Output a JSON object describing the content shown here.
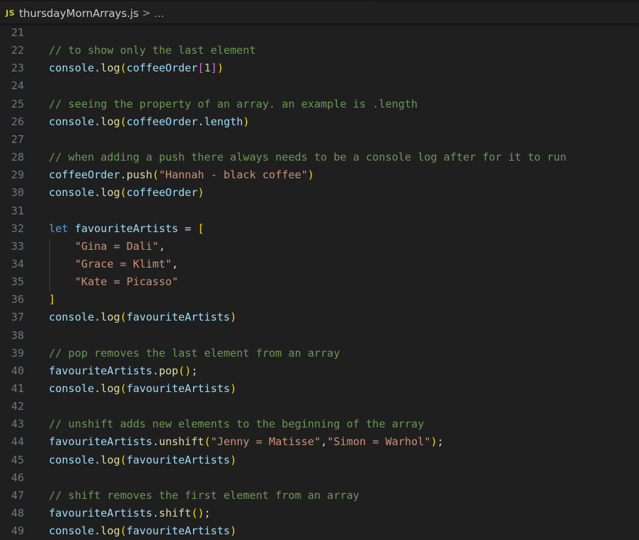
{
  "breadcrumb": {
    "language_icon": "JS",
    "language_icon_name": "javascript-file-icon",
    "file_name": "thursdayMornArrays.js",
    "separator": ">",
    "more": "..."
  },
  "colors": {
    "background": "#1f1f1f",
    "line_number": "#6e7681",
    "comment": "#6a9955",
    "variable": "#9cdcfe",
    "function": "#dcdcaa",
    "string": "#ce9178",
    "keyword": "#569cd6",
    "bracket_level1": "#ffd700",
    "bracket_level2": "#da70d6",
    "number": "#b5cea8",
    "js_icon": "#cbcb41"
  },
  "editor": {
    "lines": [
      {
        "n": "21",
        "tokens": []
      },
      {
        "n": "22",
        "tokens": [
          {
            "t": "comment",
            "v": "// to show only the last element"
          }
        ]
      },
      {
        "n": "23",
        "tokens": [
          {
            "t": "var",
            "v": "console"
          },
          {
            "t": "punc",
            "v": "."
          },
          {
            "t": "fn",
            "v": "log"
          },
          {
            "t": "b1",
            "v": "("
          },
          {
            "t": "var",
            "v": "coffeeOrder"
          },
          {
            "t": "b2",
            "v": "["
          },
          {
            "t": "num",
            "v": "1"
          },
          {
            "t": "b2",
            "v": "]"
          },
          {
            "t": "b1",
            "v": ")"
          }
        ]
      },
      {
        "n": "24",
        "tokens": []
      },
      {
        "n": "25",
        "tokens": [
          {
            "t": "comment",
            "v": "// seeing the property of an array. an example is .length"
          }
        ]
      },
      {
        "n": "26",
        "tokens": [
          {
            "t": "var",
            "v": "console"
          },
          {
            "t": "punc",
            "v": "."
          },
          {
            "t": "fn",
            "v": "log"
          },
          {
            "t": "b1",
            "v": "("
          },
          {
            "t": "var",
            "v": "coffeeOrder"
          },
          {
            "t": "punc",
            "v": "."
          },
          {
            "t": "var",
            "v": "length"
          },
          {
            "t": "b1",
            "v": ")"
          }
        ]
      },
      {
        "n": "27",
        "tokens": []
      },
      {
        "n": "28",
        "tokens": [
          {
            "t": "comment",
            "v": "// when adding a push there always needs to be a console log after for it to run"
          }
        ]
      },
      {
        "n": "29",
        "tokens": [
          {
            "t": "var",
            "v": "coffeeOrder"
          },
          {
            "t": "punc",
            "v": "."
          },
          {
            "t": "fn",
            "v": "push"
          },
          {
            "t": "b1",
            "v": "("
          },
          {
            "t": "str",
            "v": "\"Hannah - black coffee\""
          },
          {
            "t": "b1",
            "v": ")"
          }
        ]
      },
      {
        "n": "30",
        "tokens": [
          {
            "t": "var",
            "v": "console"
          },
          {
            "t": "punc",
            "v": "."
          },
          {
            "t": "fn",
            "v": "log"
          },
          {
            "t": "b1",
            "v": "("
          },
          {
            "t": "var",
            "v": "coffeeOrder"
          },
          {
            "t": "b1",
            "v": ")"
          }
        ]
      },
      {
        "n": "31",
        "tokens": []
      },
      {
        "n": "32",
        "tokens": [
          {
            "t": "kw",
            "v": "let"
          },
          {
            "t": "punc",
            "v": " "
          },
          {
            "t": "var",
            "v": "favouriteArtists"
          },
          {
            "t": "punc",
            "v": " = "
          },
          {
            "t": "b1",
            "v": "["
          }
        ]
      },
      {
        "n": "33",
        "tokens": [
          {
            "t": "punc",
            "v": "    "
          },
          {
            "t": "str",
            "v": "\"Gina = Dali\""
          },
          {
            "t": "punc",
            "v": ","
          }
        ]
      },
      {
        "n": "34",
        "tokens": [
          {
            "t": "punc",
            "v": "    "
          },
          {
            "t": "str",
            "v": "\"Grace = Klimt\""
          },
          {
            "t": "punc",
            "v": ","
          }
        ]
      },
      {
        "n": "35",
        "tokens": [
          {
            "t": "punc",
            "v": "    "
          },
          {
            "t": "str",
            "v": "\"Kate = Picasso\""
          }
        ]
      },
      {
        "n": "36",
        "tokens": [
          {
            "t": "b1",
            "v": "]"
          }
        ]
      },
      {
        "n": "37",
        "tokens": [
          {
            "t": "var",
            "v": "console"
          },
          {
            "t": "punc",
            "v": "."
          },
          {
            "t": "fn",
            "v": "log"
          },
          {
            "t": "b1",
            "v": "("
          },
          {
            "t": "var",
            "v": "favouriteArtists"
          },
          {
            "t": "b1",
            "v": ")"
          }
        ]
      },
      {
        "n": "38",
        "tokens": []
      },
      {
        "n": "39",
        "tokens": [
          {
            "t": "comment",
            "v": "// pop removes the last element from an array"
          }
        ]
      },
      {
        "n": "40",
        "tokens": [
          {
            "t": "var",
            "v": "favouriteArtists"
          },
          {
            "t": "punc",
            "v": "."
          },
          {
            "t": "fn",
            "v": "pop"
          },
          {
            "t": "b1",
            "v": "()"
          },
          {
            "t": "punc",
            "v": ";"
          }
        ]
      },
      {
        "n": "41",
        "tokens": [
          {
            "t": "var",
            "v": "console"
          },
          {
            "t": "punc",
            "v": "."
          },
          {
            "t": "fn",
            "v": "log"
          },
          {
            "t": "b1",
            "v": "("
          },
          {
            "t": "var",
            "v": "favouriteArtists"
          },
          {
            "t": "b1",
            "v": ")"
          }
        ]
      },
      {
        "n": "42",
        "tokens": []
      },
      {
        "n": "43",
        "tokens": [
          {
            "t": "comment",
            "v": "// unshift adds new elements to the beginning of the array"
          }
        ]
      },
      {
        "n": "44",
        "tokens": [
          {
            "t": "var",
            "v": "favouriteArtists"
          },
          {
            "t": "punc",
            "v": "."
          },
          {
            "t": "fn",
            "v": "unshift"
          },
          {
            "t": "b1",
            "v": "("
          },
          {
            "t": "str",
            "v": "\"Jenny = Matisse\""
          },
          {
            "t": "punc",
            "v": ","
          },
          {
            "t": "str",
            "v": "\"Simon = Warhol\""
          },
          {
            "t": "b1",
            "v": ")"
          },
          {
            "t": "punc",
            "v": ";"
          }
        ]
      },
      {
        "n": "45",
        "tokens": [
          {
            "t": "var",
            "v": "console"
          },
          {
            "t": "punc",
            "v": "."
          },
          {
            "t": "fn",
            "v": "log"
          },
          {
            "t": "b1",
            "v": "("
          },
          {
            "t": "var",
            "v": "favouriteArtists"
          },
          {
            "t": "b1",
            "v": ")"
          }
        ]
      },
      {
        "n": "46",
        "tokens": []
      },
      {
        "n": "47",
        "tokens": [
          {
            "t": "comment",
            "v": "// shift removes the first element from an array"
          }
        ]
      },
      {
        "n": "48",
        "tokens": [
          {
            "t": "var",
            "v": "favouriteArtists"
          },
          {
            "t": "punc",
            "v": "."
          },
          {
            "t": "fn",
            "v": "shift"
          },
          {
            "t": "b1",
            "v": "()"
          },
          {
            "t": "punc",
            "v": ";"
          }
        ]
      },
      {
        "n": "49",
        "tokens": [
          {
            "t": "var",
            "v": "console"
          },
          {
            "t": "punc",
            "v": "."
          },
          {
            "t": "fn",
            "v": "log"
          },
          {
            "t": "b1",
            "v": "("
          },
          {
            "t": "var",
            "v": "favouriteArtists"
          },
          {
            "t": "b1",
            "v": ")"
          }
        ]
      }
    ]
  }
}
